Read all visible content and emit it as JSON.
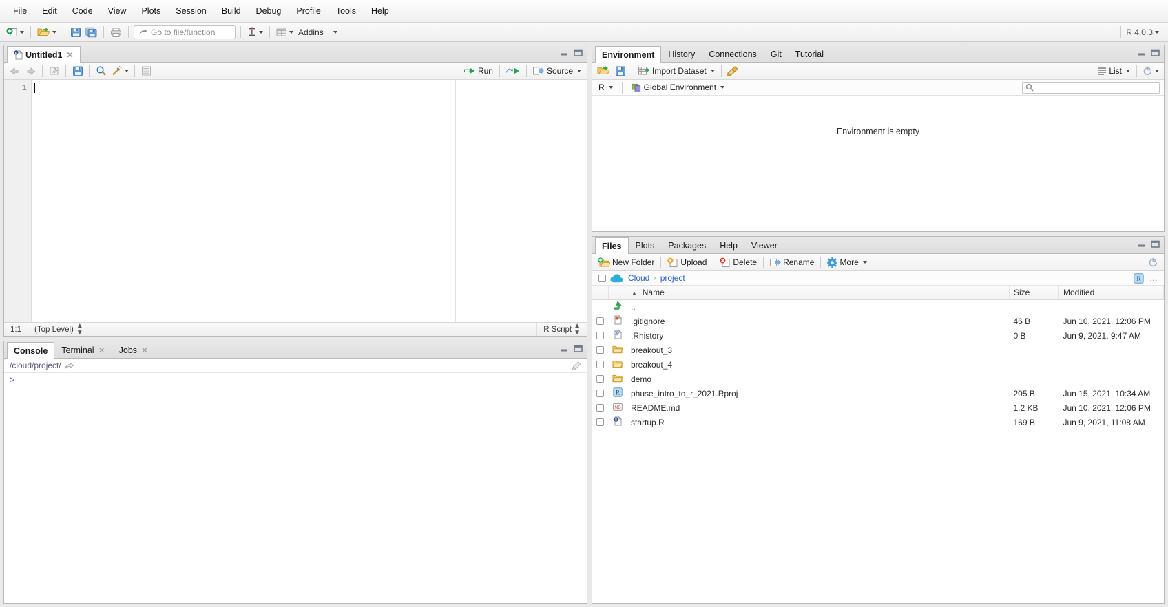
{
  "menu": {
    "items": [
      "File",
      "Edit",
      "Code",
      "View",
      "Plots",
      "Session",
      "Build",
      "Debug",
      "Profile",
      "Tools",
      "Help"
    ]
  },
  "toolbar": {
    "new_file_label": "new-file",
    "open_label": "open-file",
    "save_label": "save",
    "save_all_label": "save-all",
    "print_label": "print",
    "goto_placeholder": "Go to file/function",
    "goto_value": "",
    "addins_label": "Addins",
    "r_version": "R 4.0.3"
  },
  "source": {
    "tabs": [
      {
        "label": "Untitled1",
        "icon": "r-script-icon",
        "active": true,
        "closable": true
      }
    ],
    "toolbar": {
      "back_label": "back",
      "forward_label": "forward",
      "popout_label": "show-in-new-window",
      "save_label": "save",
      "find_label": "find-replace",
      "magic_label": "code-tools",
      "outline_label": "document-outline",
      "run_label": "Run",
      "rerun_label": "re-run",
      "source_label": "Source"
    },
    "gutter_lines": [
      "1"
    ],
    "code": "",
    "status": {
      "cursor": "1:1",
      "scope": "(Top Level)",
      "file_type": "R Script"
    }
  },
  "console": {
    "tabs": [
      {
        "label": "Console",
        "active": true,
        "closable": false
      },
      {
        "label": "Terminal",
        "active": false,
        "closable": true
      },
      {
        "label": "Jobs",
        "active": false,
        "closable": true
      }
    ],
    "working_dir": "/cloud/project/",
    "prompt": ">",
    "input": ""
  },
  "environment": {
    "tabs": [
      {
        "label": "Environment",
        "active": true
      },
      {
        "label": "History",
        "active": false
      },
      {
        "label": "Connections",
        "active": false
      },
      {
        "label": "Git",
        "active": false
      },
      {
        "label": "Tutorial",
        "active": false
      }
    ],
    "toolbar": {
      "load_label": "load-workspace",
      "save_label": "save-workspace",
      "import_label": "Import Dataset",
      "broom_label": "clear-objects",
      "view_mode": "List",
      "refresh_label": "refresh"
    },
    "scope": {
      "language": "R",
      "env_name": "Global Environment"
    },
    "search_value": "",
    "empty_message": "Environment is empty"
  },
  "files": {
    "tabs": [
      {
        "label": "Files",
        "active": true
      },
      {
        "label": "Plots",
        "active": false
      },
      {
        "label": "Packages",
        "active": false
      },
      {
        "label": "Help",
        "active": false
      },
      {
        "label": "Viewer",
        "active": false
      }
    ],
    "toolbar": {
      "new_folder_label": "New Folder",
      "upload_label": "Upload",
      "delete_label": "Delete",
      "rename_label": "Rename",
      "more_label": "More",
      "refresh_label": "refresh"
    },
    "breadcrumb": {
      "root": "Cloud",
      "separator": "›",
      "current": "project",
      "project_badge": "R",
      "overflow": "…"
    },
    "columns": {
      "sort_indicator": "▲",
      "name": "Name",
      "size": "Size",
      "modified": "Modified"
    },
    "rows": [
      {
        "name": "..",
        "icon": "up-arrow-icon",
        "size": "",
        "modified": "",
        "checkbox": false
      },
      {
        "name": ".gitignore",
        "icon": "git-file-icon",
        "size": "46 B",
        "modified": "Jun 10, 2021, 12:06 PM",
        "checkbox": true
      },
      {
        "name": ".Rhistory",
        "icon": "history-icon",
        "size": "0 B",
        "modified": "Jun 9, 2021, 9:47 AM",
        "checkbox": true
      },
      {
        "name": "breakout_3",
        "icon": "folder-icon",
        "size": "",
        "modified": "",
        "checkbox": true
      },
      {
        "name": "breakout_4",
        "icon": "folder-icon",
        "size": "",
        "modified": "",
        "checkbox": true
      },
      {
        "name": "demo",
        "icon": "folder-icon",
        "size": "",
        "modified": "",
        "checkbox": true
      },
      {
        "name": "phuse_intro_to_r_2021.Rproj",
        "icon": "rproj-icon",
        "size": "205 B",
        "modified": "Jun 15, 2021, 10:34 AM",
        "checkbox": true
      },
      {
        "name": "README.md",
        "icon": "markdown-icon",
        "size": "1.2 KB",
        "modified": "Jun 10, 2021, 12:06 PM",
        "checkbox": true
      },
      {
        "name": "startup.R",
        "icon": "r-script-icon",
        "size": "169 B",
        "modified": "Jun 9, 2021, 11:08 AM",
        "checkbox": true
      }
    ]
  },
  "colors": {
    "link": "#2a3ea8",
    "crumb": "#2d62cf",
    "prompt": "#2b57c4",
    "accent_green": "#2e9e4f",
    "folder": "#f0c060"
  }
}
